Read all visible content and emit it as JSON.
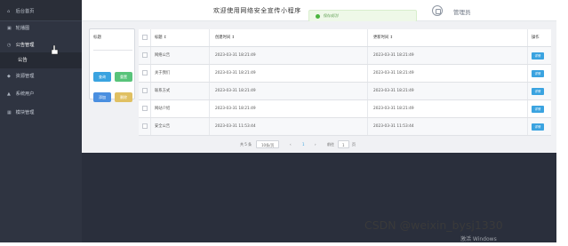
{
  "sidebar": {
    "brand": "",
    "items": [
      {
        "label": "后台首页",
        "icon": "home-icon",
        "glyph": "⌂"
      },
      {
        "label": "轮播图",
        "icon": "image-icon",
        "glyph": "▣"
      },
      {
        "label": "公告管理",
        "icon": "notice-icon",
        "glyph": "◷",
        "expanded": true
      },
      {
        "label": "资源管理",
        "icon": "resource-icon",
        "glyph": "◆"
      },
      {
        "label": "系统用户",
        "icon": "user-icon",
        "glyph": "▲"
      },
      {
        "label": "模块管理",
        "icon": "module-icon",
        "glyph": "▦"
      }
    ],
    "sub_item": "公告"
  },
  "header": {
    "welcome": "欢迎使用网络安全宣传小程序",
    "toast": "保存成功!",
    "admin": "管理员"
  },
  "search": {
    "label": "标题",
    "placeholder": "",
    "query_label": "查询",
    "reset_label": "重置",
    "add_label": "添加",
    "delete_label": "删除"
  },
  "table": {
    "columns": [
      "",
      "标题 ↕",
      "创建时间 ↕",
      "更新时间 ↕",
      "操作"
    ],
    "rows": [
      {
        "title": "网络公告",
        "created": "2023-03-31 18:21:49",
        "updated": "2023-03-31 18:21:49"
      },
      {
        "title": "关于我们",
        "created": "2023-03-31 18:21:49",
        "updated": "2023-03-31 18:21:49"
      },
      {
        "title": "联系方式",
        "created": "2023-03-31 18:21:49",
        "updated": "2023-03-31 18:21:49"
      },
      {
        "title": "网站介绍",
        "created": "2023-03-31 18:21:49",
        "updated": "2023-03-31 18:21:49"
      },
      {
        "title": "安全公告",
        "created": "2023-03-31 11:53:44",
        "updated": "2023-03-31 11:53:44"
      }
    ],
    "edit_label": "详情"
  },
  "pager": {
    "total": "共 5 条",
    "page_size": "10条/页",
    "prev": "‹",
    "current": "1",
    "next": "›",
    "goto_prefix": "前往",
    "goto_value": "1",
    "goto_suffix": "页"
  },
  "overlay": {
    "watermark": "CSDN @weixin_bysj1330",
    "windows_hint": "激活 Windows"
  },
  "colors": {
    "sidebar_bg": "#2f3441",
    "primary": "#3aa3e0",
    "success": "#58c37a",
    "warning": "#e0c062"
  }
}
